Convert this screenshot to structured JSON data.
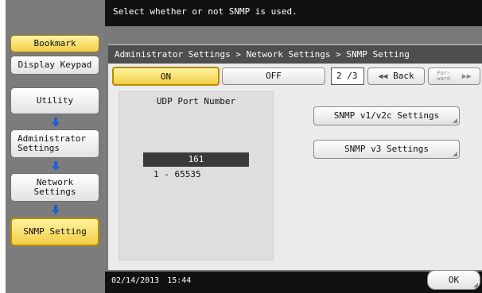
{
  "message": "Select whether or not SNMP is used.",
  "breadcrumb": "Administrator Settings > Network Settings > SNMP Setting",
  "left": {
    "bookmark": "Bookmark",
    "display_keypad": "Display Keypad",
    "utility": "Utility",
    "administrator_settings_line1": "Administrator",
    "administrator_settings_line2": "Settings",
    "network_settings_line1": "Network",
    "network_settings_line2": "Settings",
    "snmp_setting": "SNMP Setting"
  },
  "toggle": {
    "on": "ON",
    "off": "OFF"
  },
  "paging": {
    "indicator": "2 /3",
    "back": "Back",
    "forward_line1": "For-",
    "forward_line2": "ward"
  },
  "udp": {
    "title": "UDP Port Number",
    "value": "161",
    "range": "1  -  65535"
  },
  "buttons": {
    "snmp_v1v2c": "SNMP v1/v2c Settings",
    "snmp_v3": "SNMP v3 Settings",
    "ok": "OK"
  },
  "status": {
    "date": "02/14/2013",
    "time": "15:44"
  },
  "colors": {
    "accent_yellow": "#f2cd45",
    "arrow_blue": "#1f5fd6",
    "bar_dark": "#111111"
  }
}
